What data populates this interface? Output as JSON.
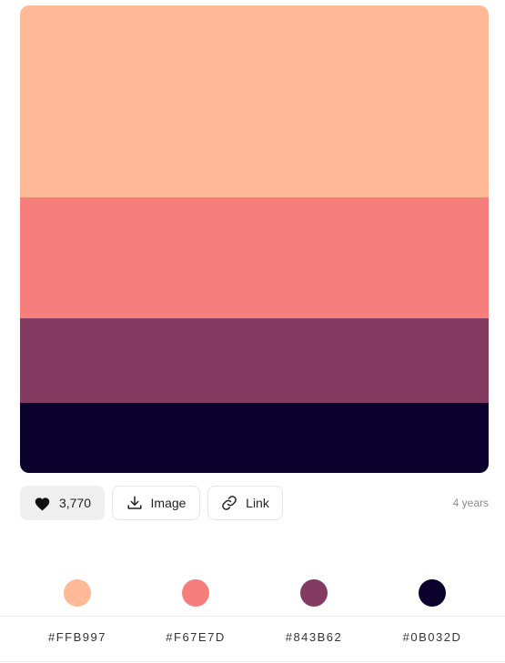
{
  "palette": {
    "colors": [
      {
        "hex": "#FFB997",
        "color": "#ffb997"
      },
      {
        "hex": "#F67E7D",
        "color": "#f67e7d"
      },
      {
        "hex": "#843B62",
        "color": "#843b62"
      },
      {
        "hex": "#0B032D",
        "color": "#0b032d"
      }
    ]
  },
  "actions": {
    "like_count": "3,770",
    "like_icon": "heart-icon",
    "image_label": "Image",
    "image_icon": "download-icon",
    "link_label": "Link",
    "link_icon": "link-icon",
    "age": "4 years"
  }
}
